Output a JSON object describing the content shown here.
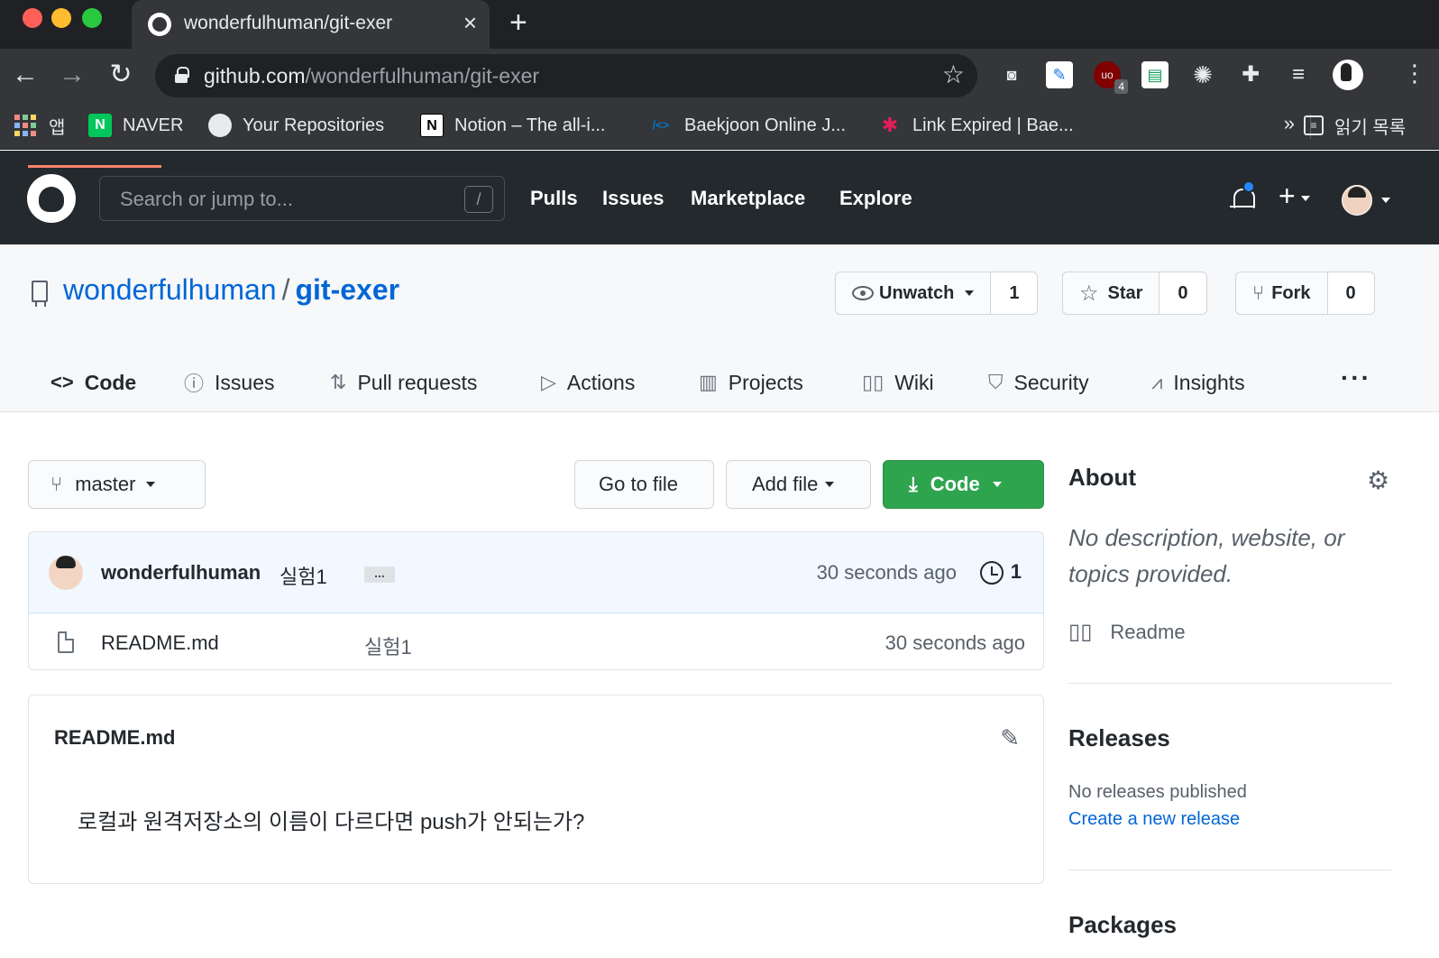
{
  "browser": {
    "tab_title": "wonderfulhuman/git-exer",
    "tab_close": "×",
    "new_tab": "+",
    "url_host": "github.com",
    "url_path": "/wonderfulhuman/git-exer",
    "ext_badge": "4",
    "bookmarks": [
      {
        "label": "앱",
        "icon": "apps-icon"
      },
      {
        "label": "NAVER",
        "icon": "naver-icon",
        "icon_text": "N",
        "color": "#03c75a"
      },
      {
        "label": "Your Repositories",
        "icon": "github-icon"
      },
      {
        "label": "Notion – The all-i...",
        "icon": "notion-icon",
        "icon_text": "N"
      },
      {
        "label": "Baekjoon Online J...",
        "icon": "code-icon",
        "icon_text": "/<>"
      },
      {
        "label": "Link Expired | Bae...",
        "icon": "slack-icon",
        "icon_text": "✱"
      }
    ],
    "more": "»",
    "reading_list": "읽기 목록"
  },
  "gh_header": {
    "search_placeholder": "Search or jump to...",
    "search_shortcut": "/",
    "nav": [
      "Pulls",
      "Issues",
      "Marketplace",
      "Explore"
    ],
    "plus": "+"
  },
  "repo": {
    "owner": "wonderfulhuman",
    "separator": "/",
    "name": "git-exer",
    "watch_label": "Unwatch",
    "watch_count": "1",
    "star_label": "Star",
    "star_count": "0",
    "fork_label": "Fork",
    "fork_count": "0",
    "tabs": [
      {
        "label": "Code",
        "icon": "code-icon",
        "glyph": "<>"
      },
      {
        "label": "Issues",
        "icon": "issue-icon",
        "glyph": "ⓘ"
      },
      {
        "label": "Pull requests",
        "icon": "pull-request-icon",
        "glyph": "⇅"
      },
      {
        "label": "Actions",
        "icon": "play-icon",
        "glyph": "▷"
      },
      {
        "label": "Projects",
        "icon": "project-icon",
        "glyph": "▥"
      },
      {
        "label": "Wiki",
        "icon": "book-icon",
        "glyph": "📖"
      },
      {
        "label": "Security",
        "icon": "shield-icon",
        "glyph": "⛉"
      },
      {
        "label": "Insights",
        "icon": "graph-icon",
        "glyph": "⩘"
      }
    ],
    "more": "···"
  },
  "code": {
    "branch": "master",
    "go_to_file": "Go to file",
    "add_file": "Add file",
    "code_button": "Code",
    "commit": {
      "author": "wonderfulhuman",
      "message": "실험1",
      "ellipsis": "...",
      "time": "30 seconds ago",
      "count": "1"
    },
    "files": [
      {
        "name": "README.md",
        "message": "실험1",
        "time": "30 seconds ago"
      }
    ],
    "readme": {
      "title": "README.md",
      "content": "로컬과 원격저장소의 이름이 다르다면 push가 안되는가?"
    }
  },
  "sidebar": {
    "about_title": "About",
    "about_desc": "No description, website, or topics provided.",
    "readme_link": "Readme",
    "releases_title": "Releases",
    "no_releases": "No releases published",
    "create_release": "Create a new release",
    "packages_title": "Packages"
  },
  "colors": {
    "header_bg": "#24292e",
    "link": "#0366d6",
    "primary_button": "#2ea44f",
    "tab_underline": "#f9826c"
  }
}
